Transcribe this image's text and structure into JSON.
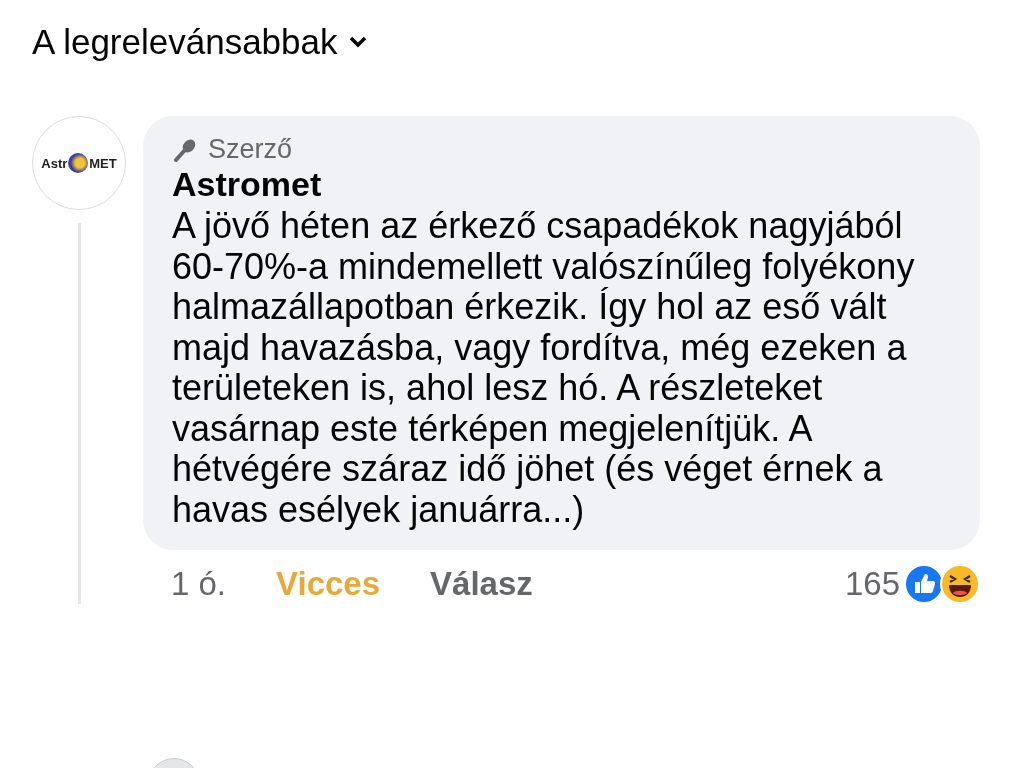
{
  "sort": {
    "label": "A legrelevánsabbak"
  },
  "comment": {
    "avatar_logo": {
      "left": "Astr",
      "right": "MET"
    },
    "badge": "Szerző",
    "author": "Astromet",
    "text": "A jövő héten az érkező csapadékok nagyjából 60-70%-a mindemellett valószínűleg folyékony halmazállapotban érkezik. Így hol az eső vált majd havazásba, vagy fordítva, még ezeken a területeken is, ahol lesz hó. A részleteket vasárnap este térképen megjelenítjük. A hétvégére száraz idő jöhet (és véget érnek a havas esélyek januárra...)",
    "time": "1 ó.",
    "reaction": {
      "label": "Vicces",
      "selected": true
    },
    "reply": "Válasz",
    "reaction_count": "165"
  }
}
